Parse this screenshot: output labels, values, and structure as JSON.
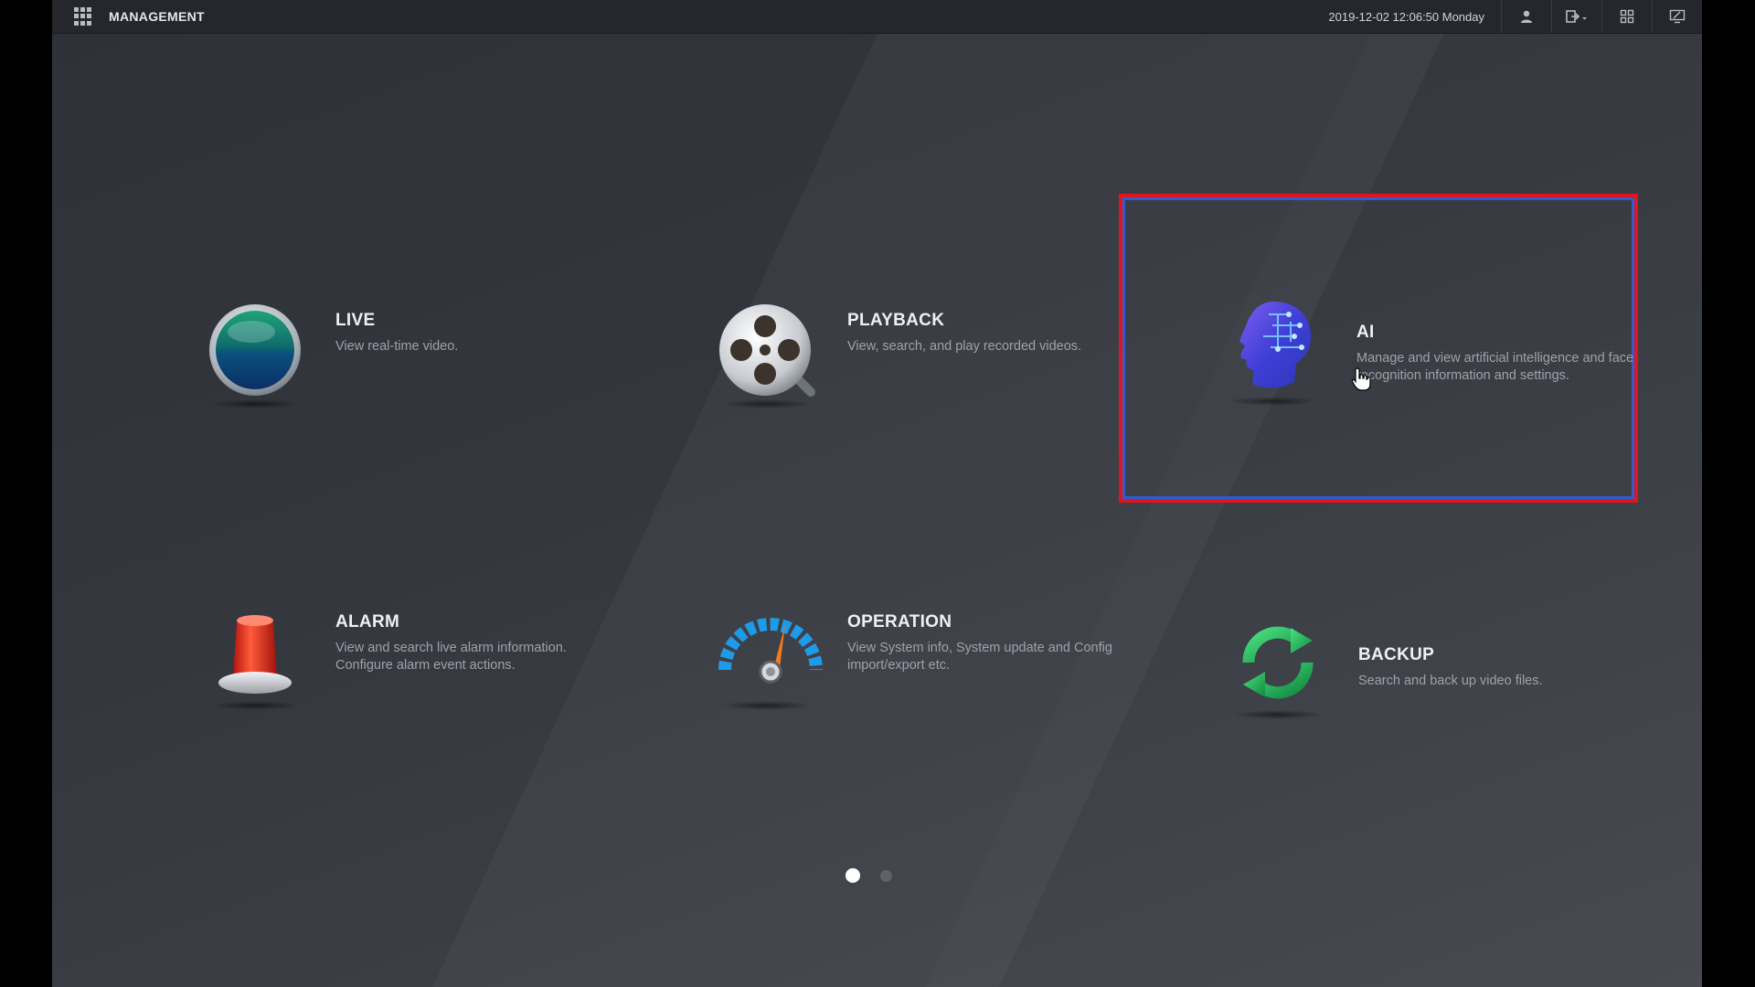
{
  "header": {
    "title": "MANAGEMENT",
    "datetime": "2019-12-02 12:06:50 Monday",
    "icons": [
      "menu-grid-icon",
      "user-icon",
      "logout-icon",
      "layout-icon",
      "monitor-icon"
    ]
  },
  "tiles": [
    {
      "id": "live",
      "name": "LIVE",
      "desc": "View real-time video.",
      "icon": "globe-icon"
    },
    {
      "id": "playback",
      "name": "PLAYBACK",
      "desc": "View, search, and play recorded videos.",
      "icon": "film-reel-icon"
    },
    {
      "id": "ai",
      "name": "AI",
      "desc": "Manage and view artificial intelligence and face recognition information and settings.",
      "icon": "ai-head-icon",
      "highlighted": true
    },
    {
      "id": "alarm",
      "name": "ALARM",
      "desc": "View and search live alarm information. Configure alarm event actions.",
      "icon": "siren-icon"
    },
    {
      "id": "operation",
      "name": "OPERATION",
      "desc": "View System info, System update and Config import/export etc.",
      "icon": "gauge-icon"
    },
    {
      "id": "backup",
      "name": "BACKUP",
      "desc": "Search and back up video files.",
      "icon": "refresh-icon"
    }
  ],
  "pager": {
    "pages": 2,
    "current": 1
  },
  "colors": {
    "highlight_outline": "#e3141d",
    "highlight_inner": "#2e5dd0"
  }
}
